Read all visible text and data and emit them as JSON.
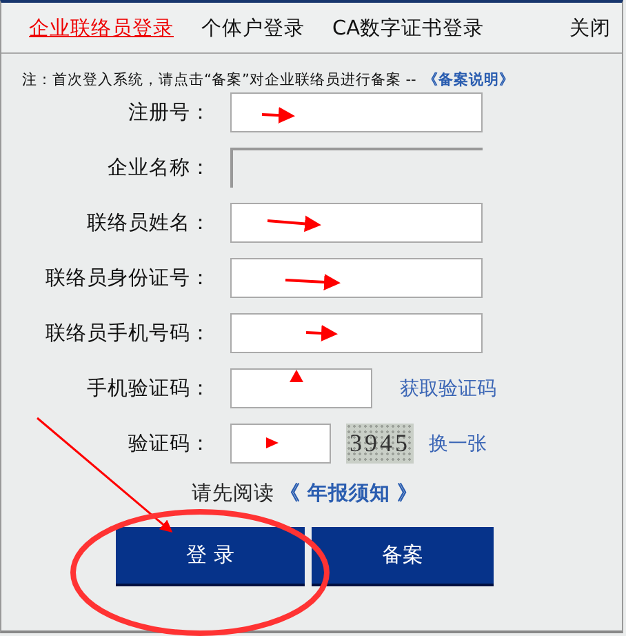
{
  "tabs": [
    {
      "label": "企业联络员登录",
      "selected": true
    },
    {
      "label": "个体户登录",
      "selected": false
    },
    {
      "label": "CA数字证书登录",
      "selected": false
    }
  ],
  "close": "关闭",
  "note": {
    "text": "注：首次登入系统，请点击“备案”对企业联络员进行备案 --",
    "link": "《备案说明》"
  },
  "fields": [
    {
      "label": "注册号：",
      "kind": "text",
      "disabled": false
    },
    {
      "label": "企业名称：",
      "kind": "text",
      "disabled": true
    },
    {
      "label": "联络员姓名：",
      "kind": "text",
      "disabled": false
    },
    {
      "label": "联络员身份证号：",
      "kind": "text",
      "disabled": false
    },
    {
      "label": "联络员手机号码：",
      "kind": "text",
      "disabled": false
    },
    {
      "label": "手机验证码：",
      "kind": "sms",
      "disabled": false,
      "action": "获取验证码"
    },
    {
      "label": "验证码：",
      "kind": "captcha",
      "disabled": false,
      "code": "3945",
      "action": "换一张"
    }
  ],
  "read_notice": {
    "prefix": "请先阅读",
    "link": "《 年报须知 》"
  },
  "buttons": [
    "登 录",
    "备案"
  ]
}
